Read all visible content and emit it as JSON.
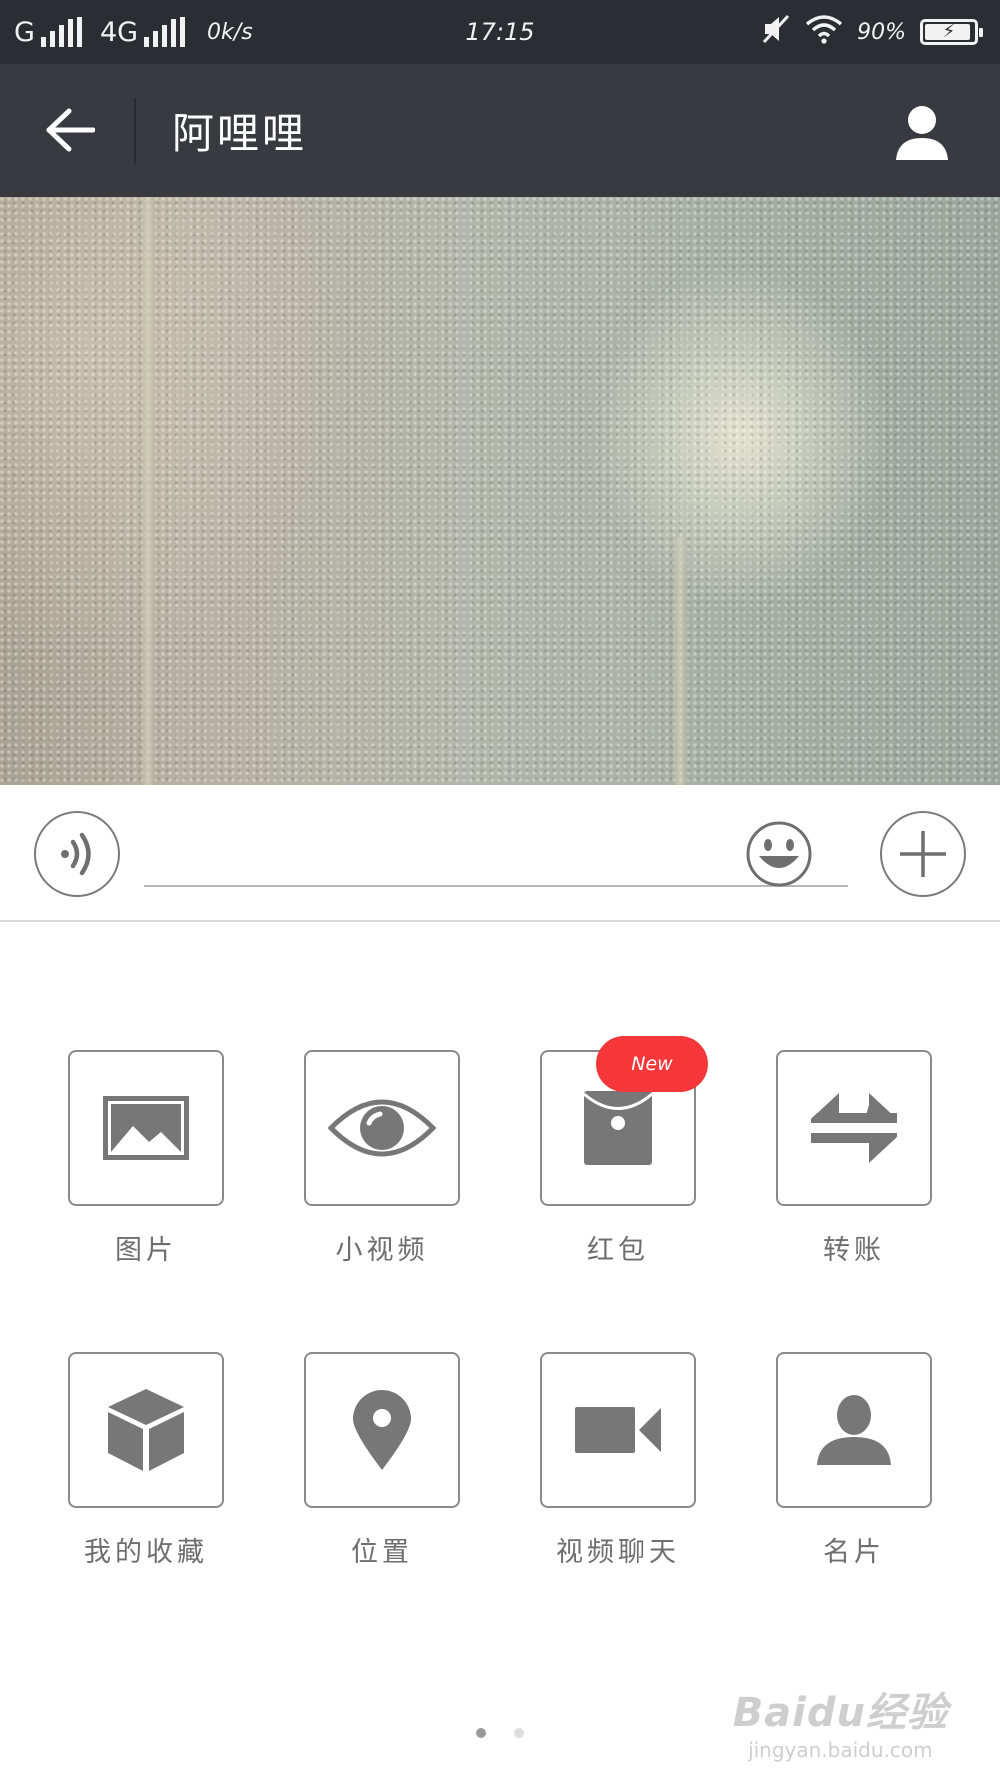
{
  "status_bar": {
    "carrier1": "G",
    "carrier2": "4G",
    "speed": "0k/s",
    "time": "17:15",
    "battery": "90%"
  },
  "header": {
    "title": "阿哩哩"
  },
  "panel": {
    "tools": [
      {
        "label": "图片",
        "icon": "image-icon"
      },
      {
        "label": "小视频",
        "icon": "eye-icon"
      },
      {
        "label": "红包",
        "icon": "red-packet-icon",
        "badge": "New"
      },
      {
        "label": "转账",
        "icon": "transfer-icon"
      },
      {
        "label": "我的收藏",
        "icon": "favorites-cube-icon"
      },
      {
        "label": "位置",
        "icon": "location-pin-icon"
      },
      {
        "label": "视频聊天",
        "icon": "video-camera-icon"
      },
      {
        "label": "名片",
        "icon": "contact-card-icon"
      }
    ],
    "page_count": 2,
    "active_page": 1
  },
  "watermark": {
    "main": "Baidu经验",
    "sub": "jingyan.baidu.com"
  },
  "colors": {
    "status_bar_bg": "#2c2d32",
    "title_bar_bg": "#393a3f",
    "badge_red": "#f5373a",
    "icon_gray": "#777777"
  }
}
